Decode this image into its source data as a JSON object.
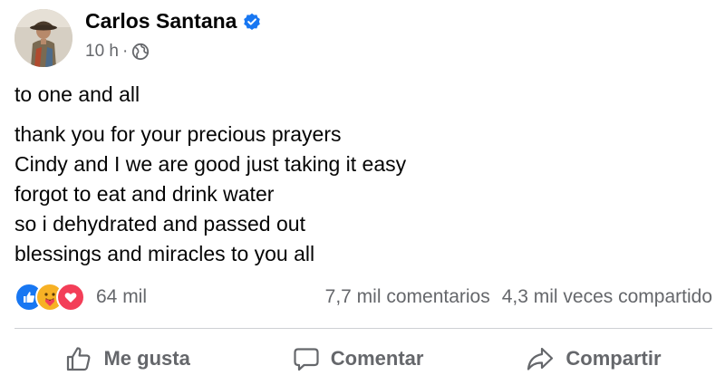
{
  "post": {
    "author": {
      "name": "Carlos Santana",
      "verified": true,
      "verified_icon": "verified-badge-icon",
      "avatar_icon": "profile-photo"
    },
    "meta": {
      "time": "10 h",
      "separator": "·",
      "audience_icon": "globe-icon"
    },
    "greeting": "to one and all",
    "lines": [
      "thank you for your precious prayers",
      "Cindy and I we are good just taking it easy",
      "forgot to eat and drink water",
      "so i dehydrated and passed out",
      "blessings and miracles to you all"
    ]
  },
  "stats": {
    "reaction_icons": [
      "like-icon",
      "care-icon",
      "love-icon"
    ],
    "reactions_count": "64 mil",
    "comments": "7,7 mil comentarios",
    "shares": "4,3 mil veces compartido"
  },
  "actions": {
    "like_label": "Me gusta",
    "comment_label": "Comentar",
    "share_label": "Compartir"
  },
  "colors": {
    "text_primary": "#050505",
    "text_secondary": "#65676b",
    "verified_blue": "#1877f2",
    "like_blue": "#1877f2",
    "love_red": "#f33e58",
    "care_yellow": "#f7b125",
    "divider": "#ced0d4"
  }
}
